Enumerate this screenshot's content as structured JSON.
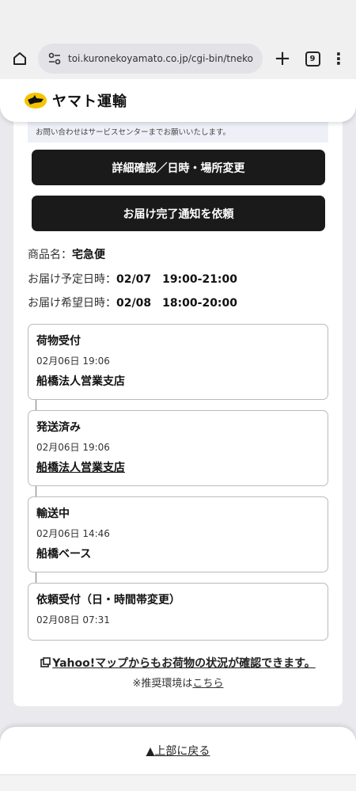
{
  "browser": {
    "url": "toi.kuronekoyamato.co.jp/cgi-bin/tneko",
    "tab_count": "9"
  },
  "header": {
    "logo_text": "ヤマト運輸"
  },
  "notice": "お問い合わせはサービスセンターまでお願いいたします。",
  "buttons": {
    "detail": "詳細確認／日時・場所変更",
    "notify": "お届け完了通知を依頼"
  },
  "info": {
    "product_label": "商品名：",
    "product_value": "宅急便",
    "scheduled_label": "お届け予定日時：",
    "scheduled_value": "02/07　19:00-21:00",
    "requested_label": "お届け希望日時：",
    "requested_value": "02/08　18:00-20:00"
  },
  "timeline": [
    {
      "status": "荷物受付",
      "datetime": "02月06日 19:06",
      "location": "船橋法人営業支店"
    },
    {
      "status": "発送済み",
      "datetime": "02月06日 19:06",
      "location": "船橋法人営業支店"
    },
    {
      "status": "輸送中",
      "datetime": "02月06日 14:46",
      "location": "船橋ベース"
    },
    {
      "status": "依頼受付（日・時間帯変更）",
      "datetime": "02月08日 07:31"
    }
  ],
  "yahoo": {
    "link_text": "Yahoo!マップからもお荷物の状況が確認できます。",
    "recommend_prefix": "※推奨環境は",
    "recommend_link": "こちら"
  },
  "footer": {
    "back_to_top": "▲上部に戻る"
  }
}
